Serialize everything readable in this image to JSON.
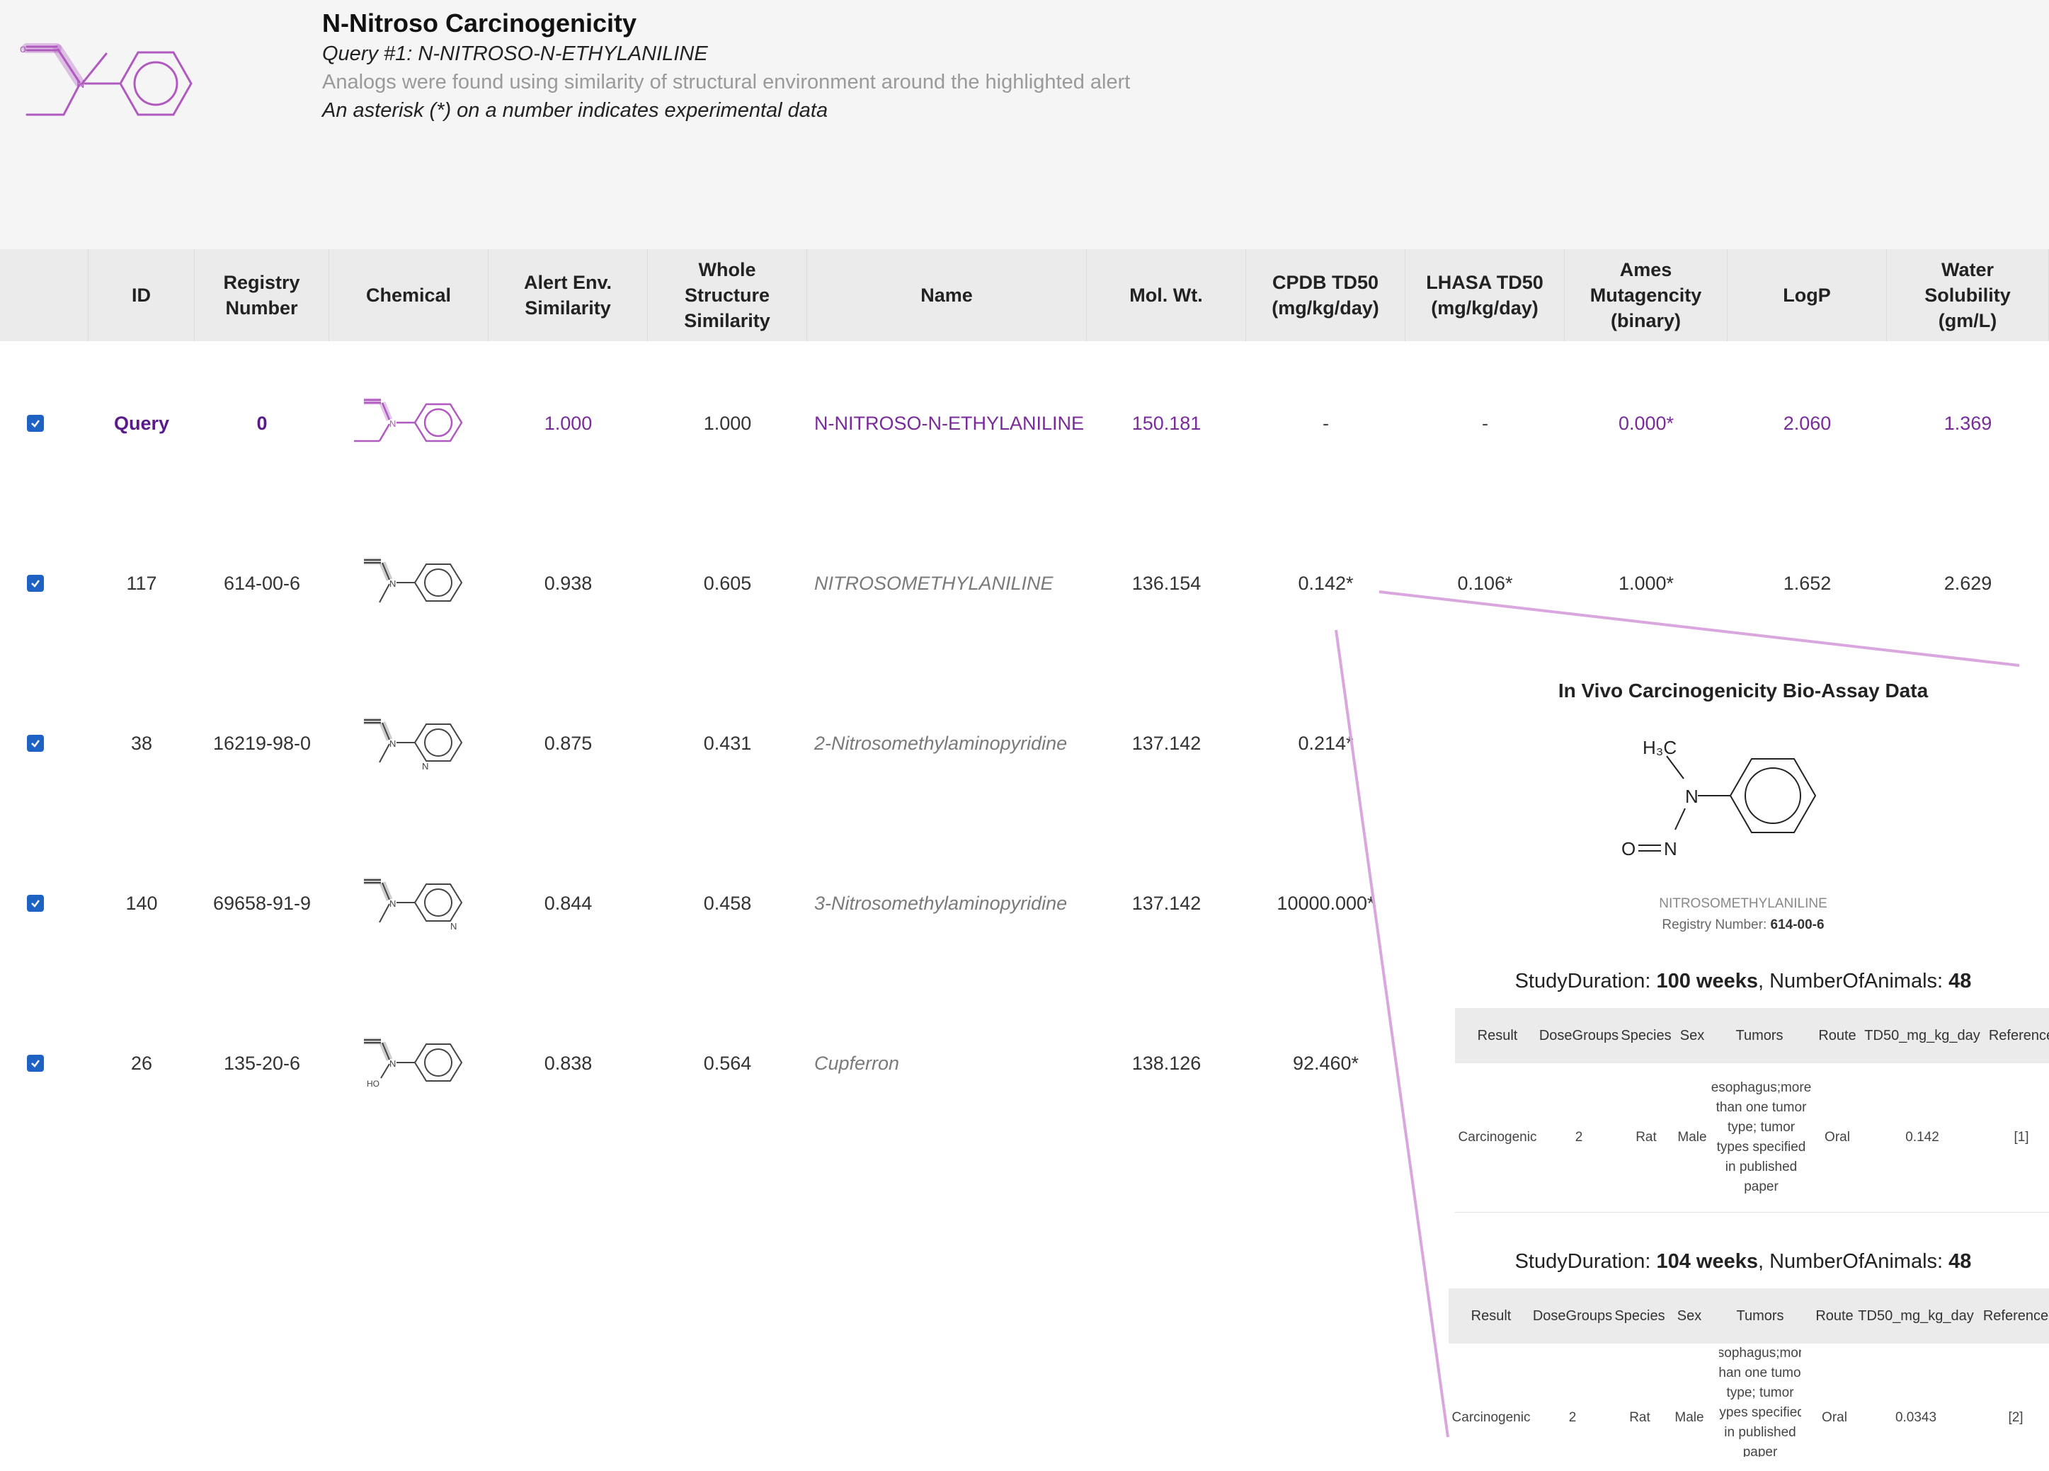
{
  "header": {
    "title": "N-Nitroso Carcinogenicity",
    "query_line": "Query #1: N-NITROSO-N-ETHYLANILINE",
    "analogs_line": "Analogs were found using similarity of structural environment around the highlighted alert",
    "asterisk_line": "An asterisk (*) on a number indicates experimental data"
  },
  "table": {
    "headers": [
      "",
      "ID",
      "Registry\nNumber",
      "Chemical",
      "Alert Env.\nSimilarity",
      "Whole\nStructure\nSimilarity",
      "Name",
      "Mol. Wt.",
      "CPDB TD50\n(mg/kg/day)",
      "LHASA TD50\n(mg/kg/day)",
      "Ames\nMutagencity\n(binary)",
      "LogP",
      "Water\nSolubility\n(gm/L)"
    ],
    "rows": [
      {
        "id": "Query",
        "reg": "0",
        "alert_sim": "1.000",
        "whole_sim": "1.000",
        "name": "N-NITROSO-N-ETHYLANILINE",
        "mw": "150.181",
        "cpdb": "-",
        "lhasa": "-",
        "ames": "0.000*",
        "logp": "2.060",
        "sol": "1.369",
        "checked": true
      },
      {
        "id": "117",
        "reg": "614-00-6",
        "alert_sim": "0.938",
        "whole_sim": "0.605",
        "name": "NITROSOMETHYLANILINE",
        "mw": "136.154",
        "cpdb": "0.142*",
        "lhasa": "0.106*",
        "ames": "1.000*",
        "logp": "1.652",
        "sol": "2.629",
        "checked": true
      },
      {
        "id": "38",
        "reg": "16219-98-0",
        "alert_sim": "0.875",
        "whole_sim": "0.431",
        "name": "2-Nitrosomethylaminopyridine",
        "mw": "137.142",
        "cpdb": "0.214*",
        "checked": true
      },
      {
        "id": "140",
        "reg": "69658-91-9",
        "alert_sim": "0.844",
        "whole_sim": "0.458",
        "name": "3-Nitrosomethylaminopyridine",
        "mw": "137.142",
        "cpdb": "10000.000*",
        "checked": true
      },
      {
        "id": "26",
        "reg": "135-20-6",
        "alert_sim": "0.838",
        "whole_sim": "0.564",
        "name": "Cupferron",
        "mw": "138.126",
        "cpdb": "92.460*",
        "checked": true
      }
    ]
  },
  "popup": {
    "title": "In Vivo Carcinogenicity Bio-Assay Data",
    "mol_labels": {
      "methyl": "H₃C",
      "n": "N",
      "o": "O",
      "nitroso_n": "N"
    },
    "chem_name": "NITROSOMETHYLANILINE",
    "registry_label": "Registry Number:",
    "registry_value": "614-00-6",
    "table_headers": [
      "Result",
      "DoseGroups",
      "Species",
      "Sex",
      "Tumors",
      "Route",
      "TD50_mg_kg_day",
      "Reference"
    ],
    "studies": [
      {
        "duration_label": "StudyDuration:",
        "duration_value": "100 weeks",
        "animals_label": ", NumberOfAnimals:",
        "animals_value": "48",
        "row": {
          "result": "Carcinogenic",
          "dose_groups": "2",
          "species": "Rat",
          "sex": "Male",
          "tumors": "esophagus;more than one tumor type; tumor types specified in published paper",
          "route": "Oral",
          "td50": "0.142",
          "reference": "[1]"
        }
      },
      {
        "duration_label": "StudyDuration:",
        "duration_value": "104 weeks",
        "animals_label": ", NumberOfAnimals:",
        "animals_value": "48",
        "row": {
          "result": "Carcinogenic",
          "dose_groups": "2",
          "species": "Rat",
          "sex": "Male",
          "tumors": "esophagus;more than one tumor type; tumor types specified in published paper",
          "route": "Oral",
          "td50": "0.0343",
          "reference": "[2]"
        }
      }
    ]
  },
  "colors": {
    "highlight": "#b05ac0",
    "accent": "#7a2a9a",
    "checkbox": "#1e63c4",
    "leader_line": "#d9a6de"
  },
  "icons": {
    "checkbox": "checkbox-checked-icon",
    "structure": "molecule-structure-icon"
  }
}
